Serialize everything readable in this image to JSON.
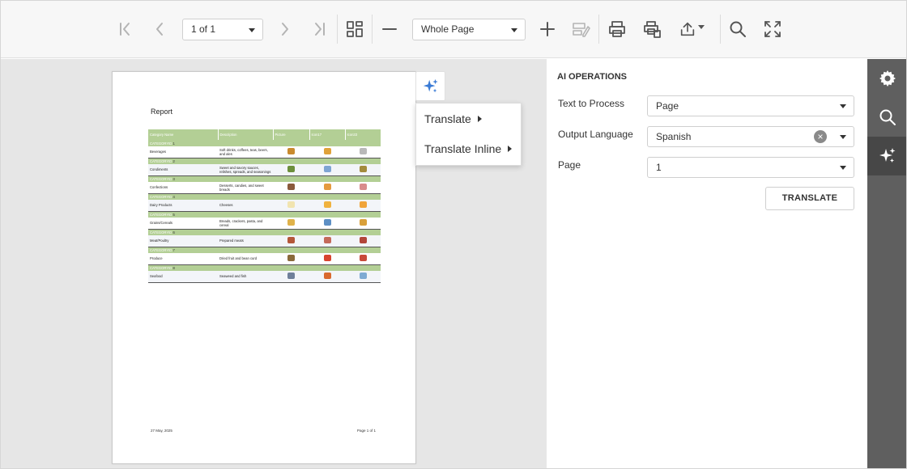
{
  "toolbar": {
    "page_selector": "1 of 1",
    "zoom_selector": "Whole Page"
  },
  "report": {
    "title": "Report",
    "columns": [
      "Category Name",
      "Description",
      "Picture",
      "Icon17",
      "Icon33"
    ],
    "category_label": "CATEGORYID",
    "rows": [
      {
        "id": "1",
        "name": "Beverages",
        "description": "Soft drinks, coffees, teas, beers, and ales",
        "colors": [
          "#c98a2e",
          "#e0a23a",
          "#b9b9b9"
        ]
      },
      {
        "id": "2",
        "name": "Condiments",
        "description": "Sweet and savory sauces, relishes, spreads, and seasonings",
        "colors": [
          "#6d8f3c",
          "#7fa5d3",
          "#a38b3c"
        ]
      },
      {
        "id": "3",
        "name": "Confections",
        "description": "Desserts, candies, and sweet breads",
        "colors": [
          "#8a5a3c",
          "#e59a3f",
          "#d98b8b"
        ]
      },
      {
        "id": "4",
        "name": "Dairy Products",
        "description": "Cheeses",
        "colors": [
          "#f1e4b0",
          "#f0b23e",
          "#f0a43a"
        ]
      },
      {
        "id": "5",
        "name": "Grains/Cereals",
        "description": "Breads, crackers, pasta, and cereal",
        "colors": [
          "#e0b24a",
          "#5d8fc4",
          "#d9a03a"
        ]
      },
      {
        "id": "6",
        "name": "Meat/Poultry",
        "description": "Prepared meats",
        "colors": [
          "#b4573a",
          "#c46a5a",
          "#b2463a"
        ]
      },
      {
        "id": "7",
        "name": "Produce",
        "description": "Dried fruit and bean curd",
        "colors": [
          "#8a6a3a",
          "#d8442e",
          "#c84a3a"
        ]
      },
      {
        "id": "8",
        "name": "Seafood",
        "description": "Seaweed and fish",
        "colors": [
          "#6f7f9a",
          "#d9692e",
          "#7faad3"
        ]
      }
    ],
    "footer_date": "27 May, 2025",
    "footer_page": "Page 1 of 1"
  },
  "ai_menu": {
    "items": [
      "Translate",
      "Translate Inline"
    ]
  },
  "panel": {
    "title": "AI OPERATIONS",
    "text_to_process_label": "Text to Process",
    "text_to_process_value": "Page",
    "output_language_label": "Output Language",
    "output_language_value": "Spanish",
    "page_label": "Page",
    "page_value": "1",
    "translate_button": "TRANSLATE"
  },
  "colors": {
    "header_green": "#b3cf95",
    "sidebar": "#5f5f5f",
    "sidebar_active": "#474747",
    "ai_accent": "#3a7bd5"
  }
}
